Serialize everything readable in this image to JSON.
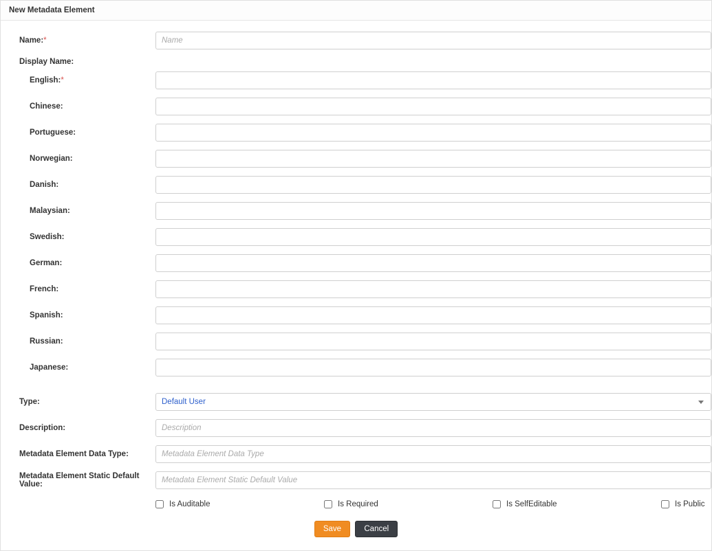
{
  "header": {
    "title": "New Metadata Element"
  },
  "labels": {
    "name": "Name:",
    "displayName": "Display Name:",
    "english": "English:",
    "chinese": "Chinese:",
    "portuguese": "Portuguese:",
    "norwegian": "Norwegian:",
    "danish": "Danish:",
    "malaysian": "Malaysian:",
    "swedish": "Swedish:",
    "german": "German:",
    "french": "French:",
    "spanish": "Spanish:",
    "russian": "Russian:",
    "japanese": "Japanese:",
    "type": "Type:",
    "description": "Description:",
    "dataType": "Metadata Element Data Type:",
    "defaultValue": "Metadata Element Static Default Value:",
    "isAuditable": "Is Auditable",
    "isRequired": "Is Required",
    "isSelfEditable": "Is SelfEditable",
    "isPublic": "Is Public",
    "requiredMark": "*"
  },
  "placeholders": {
    "name": "Name",
    "description": "Description",
    "dataType": "Metadata Element Data Type",
    "defaultValue": "Metadata Element Static Default Value"
  },
  "values": {
    "name": "",
    "english": "",
    "chinese": "",
    "portuguese": "",
    "norwegian": "",
    "danish": "",
    "malaysian": "",
    "swedish": "",
    "german": "",
    "french": "",
    "spanish": "",
    "russian": "",
    "japanese": "",
    "typeSelected": "Default User",
    "description": "",
    "dataType": "",
    "defaultValue": "",
    "isAuditable": false,
    "isRequired": false,
    "isSelfEditable": false,
    "isPublic": false
  },
  "buttons": {
    "save": "Save",
    "cancel": "Cancel"
  }
}
